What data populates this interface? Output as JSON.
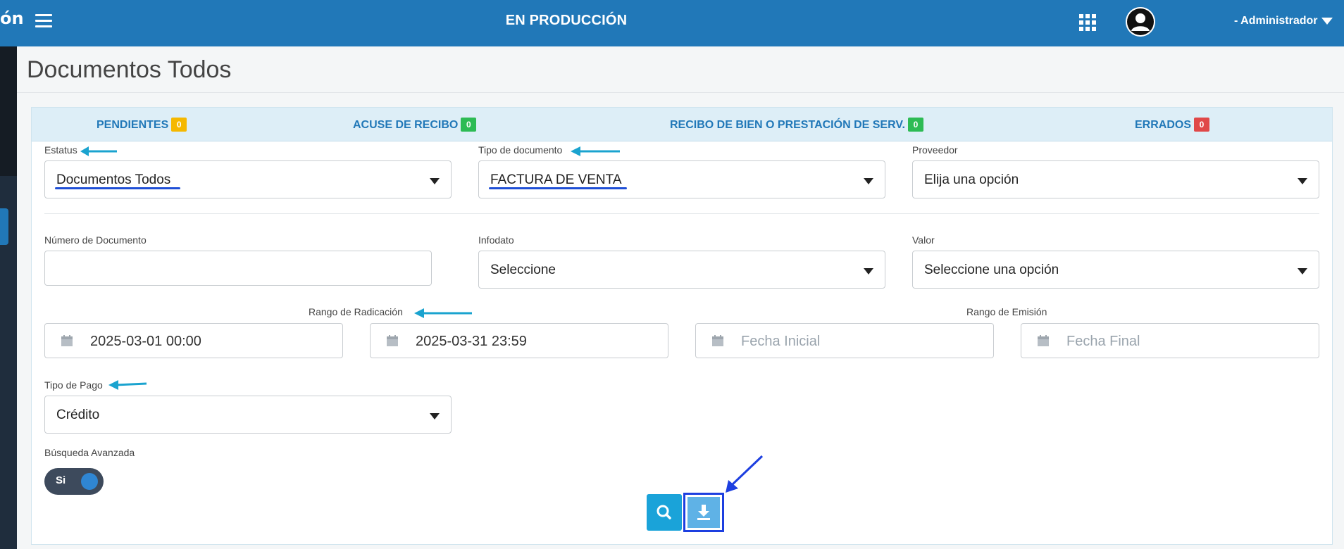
{
  "topbar": {
    "brand_fragment": "ón",
    "environment": "EN PRODUCCIÓN",
    "user_name": "- Administrador"
  },
  "page": {
    "title": "Documentos Todos"
  },
  "tabs": [
    {
      "label": "PENDIENTES",
      "count": "0",
      "badge_color": "#f5b800"
    },
    {
      "label": "ACUSE DE RECIBO",
      "count": "0",
      "badge_color": "#2dbb54"
    },
    {
      "label": "RECIBO DE BIEN O PRESTACIÓN DE SERV.",
      "count": "0",
      "badge_color": "#2dbb54"
    },
    {
      "label": "ERRADOS",
      "count": "0",
      "badge_color": "#e04848"
    }
  ],
  "filters": {
    "estatus": {
      "label": "Estatus",
      "value": "Documentos Todos"
    },
    "tipo_documento": {
      "label": "Tipo de documento",
      "value": "FACTURA DE VENTA"
    },
    "proveedor": {
      "label": "Proveedor",
      "value": "Elija una opción"
    },
    "numero_documento": {
      "label": "Número de Documento",
      "value": ""
    },
    "infodato": {
      "label": "Infodato",
      "value": "Seleccione"
    },
    "valor": {
      "label": "Valor",
      "value": "Seleccione una opción"
    },
    "rango_radicacion": {
      "label": "Rango de Radicación",
      "start": "2025-03-01 00:00",
      "end": "2025-03-31 23:59"
    },
    "rango_emision": {
      "label": "Rango de Emisión",
      "start_placeholder": "Fecha Inicial",
      "end_placeholder": "Fecha Final"
    },
    "tipo_pago": {
      "label": "Tipo de Pago",
      "value": "Crédito"
    },
    "busqueda_avanzada": {
      "label": "Búsqueda Avanzada",
      "toggle_label": "Si",
      "enabled": true
    }
  },
  "colors": {
    "topbar": "#2178b8",
    "annotation_arrow": "#1aa3cf",
    "annotation_highlight": "#1d3fe0"
  }
}
